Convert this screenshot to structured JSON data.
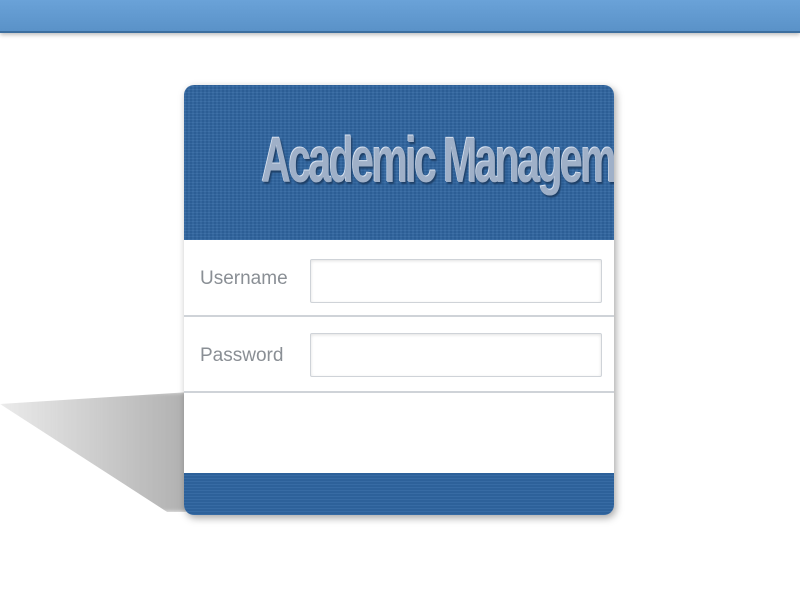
{
  "header": {
    "title": "Academic Management System"
  },
  "login_form": {
    "username": {
      "label": "Username",
      "value": "",
      "placeholder": ""
    },
    "password": {
      "label": "Password",
      "value": "",
      "placeholder": ""
    }
  },
  "colors": {
    "top_bar": "#6aa2d8",
    "card_header": "#2f65a0",
    "title_text": "#9fb0c8",
    "label_text": "#8a8f95"
  }
}
